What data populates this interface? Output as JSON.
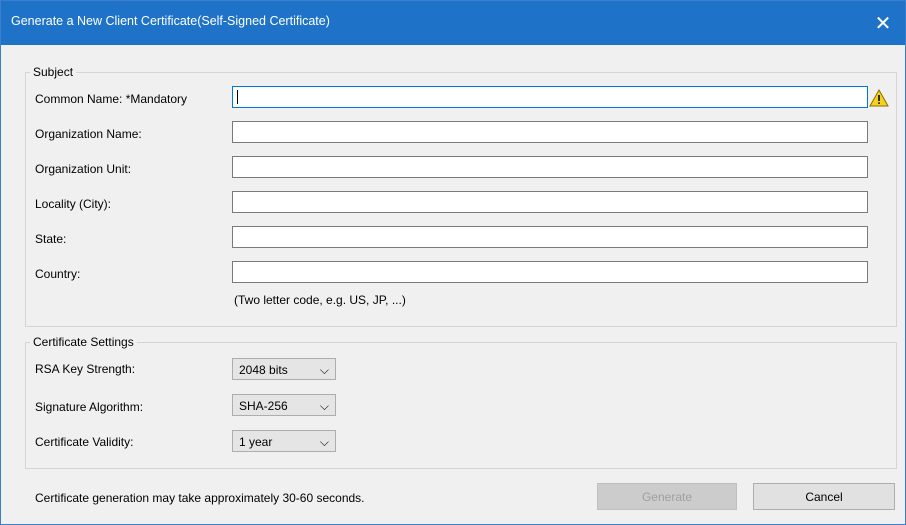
{
  "window": {
    "title": "Generate a New Client Certificate(Self-Signed Certificate)",
    "close_glyph": "✕"
  },
  "subject": {
    "legend": "Subject",
    "fields": [
      {
        "label": "Common Name: *Mandatory",
        "value": "",
        "warning_icon": "warning-triangle-icon"
      },
      {
        "label": "Organization Name:",
        "value": ""
      },
      {
        "label": "Organization Unit:",
        "value": ""
      },
      {
        "label": "Locality (City):",
        "value": ""
      },
      {
        "label": "State:",
        "value": ""
      },
      {
        "label": "Country:",
        "value": ""
      }
    ],
    "country_hint": "(Two letter code, e.g. US, JP, ...)"
  },
  "certificate_settings": {
    "legend": "Certificate Settings",
    "rows": [
      {
        "label": "RSA Key Strength:",
        "value": "2048 bits"
      },
      {
        "label": "Signature Algorithm:",
        "value": "SHA-256"
      },
      {
        "label": "Certificate Validity:",
        "value": "1 year"
      }
    ],
    "chevron_glyph": "⌵"
  },
  "footer": {
    "note": "Certificate generation may take approximately 30-60 seconds.",
    "generate_label": "Generate",
    "cancel_label": "Cancel"
  },
  "colors": {
    "titlebar": "#1e73c8",
    "focus_border": "#0078d7",
    "warning_fill": "#f5d21c"
  }
}
